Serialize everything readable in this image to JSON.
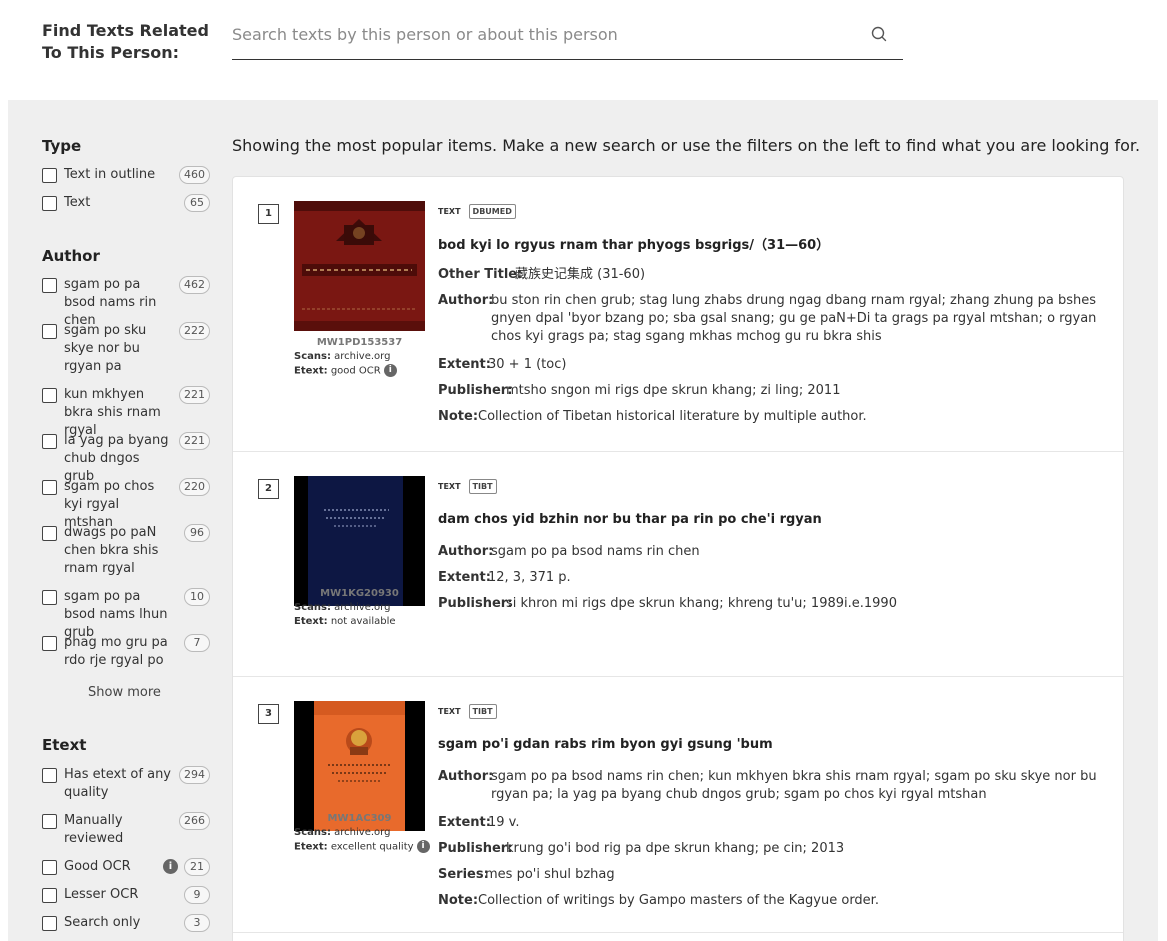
{
  "search": {
    "label": "Find Texts Related To This Person:",
    "placeholder": "Search texts by this person or about this person",
    "value": ""
  },
  "message": "Showing the most popular items. Make a new search or use the filters on the left to find what you are looking for.",
  "facets": {
    "type": {
      "title": "Type",
      "items": [
        {
          "label": "Text in outline",
          "count": "460"
        },
        {
          "label": "Text",
          "count": "65"
        }
      ]
    },
    "author": {
      "title": "Author",
      "items": [
        {
          "label": "sgam po pa bsod nams rin chen",
          "count": "462"
        },
        {
          "label": "sgam po sku skye nor bu rgyan pa",
          "count": "222"
        },
        {
          "label": "kun mkhyen bkra shis rnam rgyal",
          "count": "221"
        },
        {
          "label": "la yag pa byang chub dngos grub",
          "count": "221"
        },
        {
          "label": "sgam po chos kyi rgyal mtshan",
          "count": "220"
        },
        {
          "label": "dwags po paN chen bkra shis rnam rgyal",
          "count": "96"
        },
        {
          "label": "sgam po pa bsod nams lhun grub",
          "count": "10"
        },
        {
          "label": "phag mo gru pa rdo rje rgyal po",
          "count": "7"
        }
      ],
      "show_more": "Show more"
    },
    "etext": {
      "title": "Etext",
      "items": [
        {
          "label": "Has etext of any quality",
          "count": "294"
        },
        {
          "label": "Manually reviewed",
          "count": "266"
        },
        {
          "label": "Good OCR",
          "count": "21"
        },
        {
          "label": "Lesser OCR",
          "count": "9"
        },
        {
          "label": "Search only",
          "count": "3"
        }
      ]
    }
  },
  "results": [
    {
      "num": "1",
      "id": "MW1PD153537",
      "scans_label": "Scans:",
      "scans": "archive.org",
      "etext_label": "Etext:",
      "etext": "good OCR",
      "type_tag": "TEXT",
      "tag": "DBUMED",
      "title": "bod kyi lo rgyus rnam thar phyogs bsgrigs/（31—60）",
      "fields": [
        {
          "key": "Other Title:",
          "value": "藏族史记集成 (31-60)"
        },
        {
          "key": "Author:",
          "value": "bu ston rin chen grub; stag lung zhabs drung ngag dbang rnam rgyal; zhang zhung pa bshes gnyen dpal 'byor bzang po; sba gsal snang; gu ge paN+Di ta grags pa rgyal mtshan; o rgyan chos kyi grags pa; stag sgang mkhas mchog gu ru bkra shis"
        },
        {
          "key": "Extent:",
          "value": "30 + 1 (toc)"
        },
        {
          "key": "Publisher:",
          "value": "mtsho sngon mi rigs dpe skrun khang; zi ling; 2011"
        },
        {
          "key": "Note:",
          "value": "Collection of Tibetan historical literature by multiple author."
        }
      ]
    },
    {
      "num": "2",
      "id": "MW1KG20930",
      "scans_label": "Scans:",
      "scans": "archive.org",
      "etext_label": "Etext:",
      "etext": "not available",
      "type_tag": "TEXT",
      "tag": "TIBT",
      "title": "dam chos yid bzhin nor bu thar pa rin po che'i rgyan",
      "fields": [
        {
          "key": "Author:",
          "value": "sgam po pa bsod nams rin chen"
        },
        {
          "key": "Extent:",
          "value": "12, 3, 371 p."
        },
        {
          "key": "Publisher:",
          "value": "si khron mi rigs dpe skrun khang; khreng tu'u; 1989i.e.1990"
        }
      ]
    },
    {
      "num": "3",
      "id": "MW1AC309",
      "scans_label": "Scans:",
      "scans": "archive.org",
      "etext_label": "Etext:",
      "etext": "excellent quality",
      "type_tag": "TEXT",
      "tag": "TIBT",
      "title": "sgam po'i gdan rabs rim byon gyi gsung 'bum",
      "fields": [
        {
          "key": "Author:",
          "value": "sgam po pa bsod nams rin chen; kun mkhyen bkra shis rnam rgyal; sgam po sku skye nor bu rgyan pa; la yag pa byang chub dngos grub; sgam po chos kyi rgyal mtshan"
        },
        {
          "key": "Extent:",
          "value": "19 v."
        },
        {
          "key": "Publisher:",
          "value": "krung go'i bod rig pa dpe skrun khang; pe cin; 2013"
        },
        {
          "key": "Series:",
          "value": "mes po'i shul bzhag"
        },
        {
          "key": "Note:",
          "value": "Collection of writings by Gampo masters of the Kagyue order."
        }
      ]
    }
  ]
}
